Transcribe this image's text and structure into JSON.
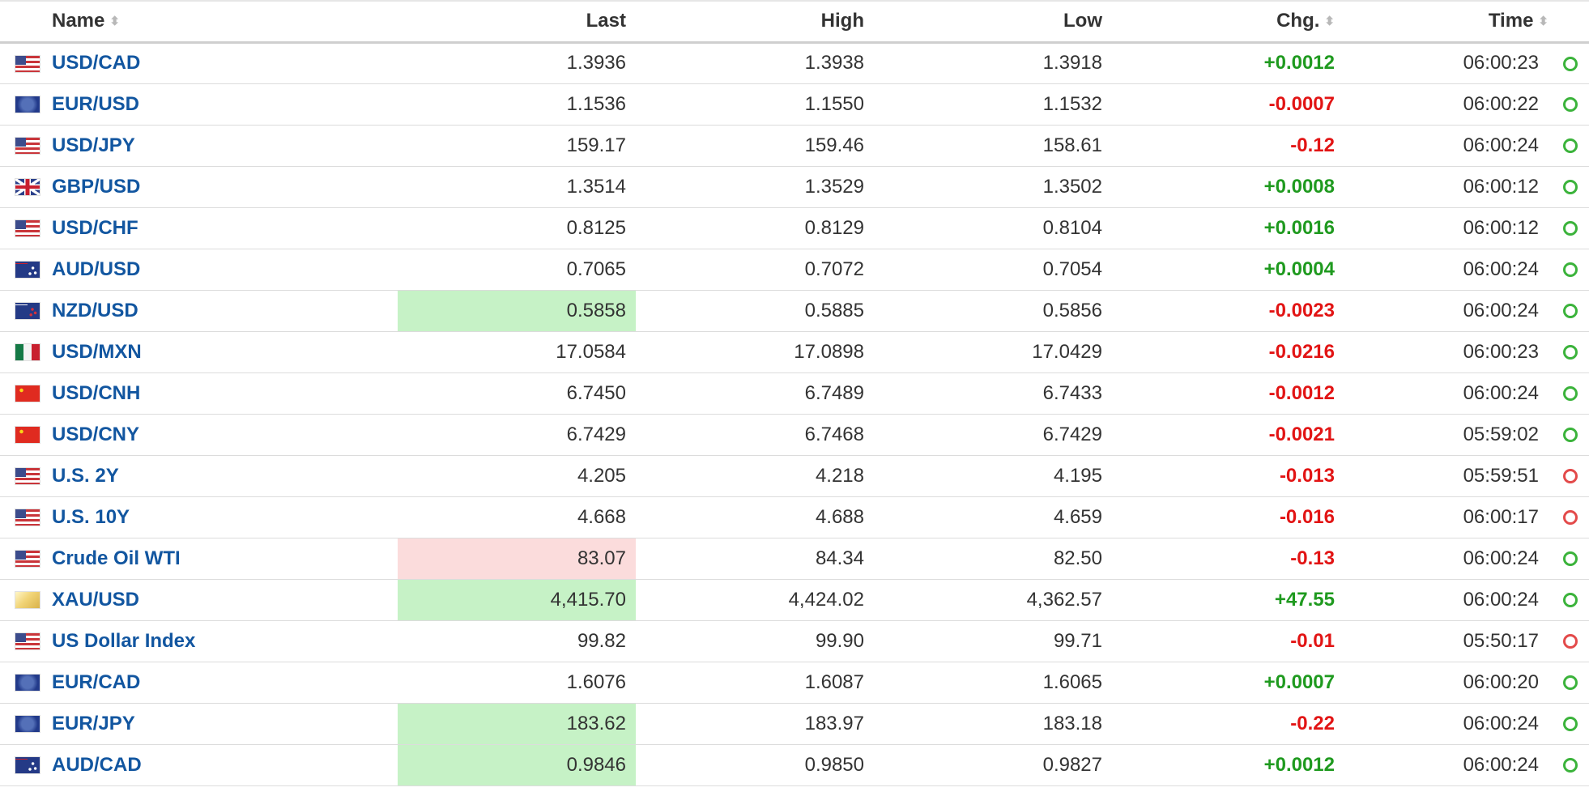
{
  "header": {
    "name": "Name",
    "last": "Last",
    "high": "High",
    "low": "Low",
    "chg": "Chg.",
    "time": "Time",
    "sort_icon": "sort-icon"
  },
  "rows": [
    {
      "name": "USD/CAD",
      "flag": "us-flag-icon",
      "last": "1.3936",
      "high": "1.3938",
      "low": "1.3918",
      "chg": "+0.0012",
      "time": "06:00:23",
      "direction": "up",
      "flash": "none",
      "status": "open"
    },
    {
      "name": "EUR/USD",
      "flag": "eu-flag-icon",
      "last": "1.1536",
      "high": "1.1550",
      "low": "1.1532",
      "chg": "-0.0007",
      "time": "06:00:22",
      "direction": "down",
      "flash": "none",
      "status": "open"
    },
    {
      "name": "USD/JPY",
      "flag": "us-flag-icon",
      "last": "159.17",
      "high": "159.46",
      "low": "158.61",
      "chg": "-0.12",
      "time": "06:00:24",
      "direction": "down",
      "flash": "none",
      "status": "open"
    },
    {
      "name": "GBP/USD",
      "flag": "uk-flag-icon",
      "last": "1.3514",
      "high": "1.3529",
      "low": "1.3502",
      "chg": "+0.0008",
      "time": "06:00:12",
      "direction": "up",
      "flash": "none",
      "status": "open"
    },
    {
      "name": "USD/CHF",
      "flag": "us-flag-icon",
      "last": "0.8125",
      "high": "0.8129",
      "low": "0.8104",
      "chg": "+0.0016",
      "time": "06:00:12",
      "direction": "up",
      "flash": "none",
      "status": "open"
    },
    {
      "name": "AUD/USD",
      "flag": "au-flag-icon",
      "last": "0.7065",
      "high": "0.7072",
      "low": "0.7054",
      "chg": "+0.0004",
      "time": "06:00:24",
      "direction": "up",
      "flash": "none",
      "status": "open"
    },
    {
      "name": "NZD/USD",
      "flag": "nz-flag-icon",
      "last": "0.5858",
      "high": "0.5885",
      "low": "0.5856",
      "chg": "-0.0023",
      "time": "06:00:24",
      "direction": "down",
      "flash": "up",
      "status": "open"
    },
    {
      "name": "USD/MXN",
      "flag": "mx-flag-icon",
      "last": "17.0584",
      "high": "17.0898",
      "low": "17.0429",
      "chg": "-0.0216",
      "time": "06:00:23",
      "direction": "down",
      "flash": "none",
      "status": "open"
    },
    {
      "name": "USD/CNH",
      "flag": "cn-flag-icon",
      "last": "6.7450",
      "high": "6.7489",
      "low": "6.7433",
      "chg": "-0.0012",
      "time": "06:00:24",
      "direction": "down",
      "flash": "none",
      "status": "open"
    },
    {
      "name": "USD/CNY",
      "flag": "cn-flag-icon",
      "last": "6.7429",
      "high": "6.7468",
      "low": "6.7429",
      "chg": "-0.0021",
      "time": "05:59:02",
      "direction": "down",
      "flash": "none",
      "status": "open"
    },
    {
      "name": "U.S. 2Y",
      "flag": "us-flag-icon",
      "last": "4.205",
      "high": "4.218",
      "low": "4.195",
      "chg": "-0.013",
      "time": "05:59:51",
      "direction": "down",
      "flash": "none",
      "status": "closed"
    },
    {
      "name": "U.S. 10Y",
      "flag": "us-flag-icon",
      "last": "4.668",
      "high": "4.688",
      "low": "4.659",
      "chg": "-0.016",
      "time": "06:00:17",
      "direction": "down",
      "flash": "none",
      "status": "closed"
    },
    {
      "name": "Crude Oil WTI",
      "flag": "us-flag-icon",
      "last": "83.07",
      "high": "84.34",
      "low": "82.50",
      "chg": "-0.13",
      "time": "06:00:24",
      "direction": "down",
      "flash": "down",
      "status": "open"
    },
    {
      "name": "XAU/USD",
      "flag": "gold-icon",
      "last": "4,415.70",
      "high": "4,424.02",
      "low": "4,362.57",
      "chg": "+47.55",
      "time": "06:00:24",
      "direction": "up",
      "flash": "up",
      "status": "open"
    },
    {
      "name": "US Dollar Index",
      "flag": "us-flag-icon",
      "last": "99.82",
      "high": "99.90",
      "low": "99.71",
      "chg": "-0.01",
      "time": "05:50:17",
      "direction": "down",
      "flash": "none",
      "status": "closed"
    },
    {
      "name": "EUR/CAD",
      "flag": "eu-flag-icon",
      "last": "1.6076",
      "high": "1.6087",
      "low": "1.6065",
      "chg": "+0.0007",
      "time": "06:00:20",
      "direction": "up",
      "flash": "none",
      "status": "open"
    },
    {
      "name": "EUR/JPY",
      "flag": "eu-flag-icon",
      "last": "183.62",
      "high": "183.97",
      "low": "183.18",
      "chg": "-0.22",
      "time": "06:00:24",
      "direction": "down",
      "flash": "up",
      "status": "open"
    },
    {
      "name": "AUD/CAD",
      "flag": "au-flag-icon",
      "last": "0.9846",
      "high": "0.9850",
      "low": "0.9827",
      "chg": "+0.0012",
      "time": "06:00:24",
      "direction": "up",
      "flash": "up",
      "status": "open"
    }
  ],
  "colors": {
    "link": "#1256a0",
    "up": "#1f9a1f",
    "down": "#e21414",
    "flash_up": "#c6f2c6",
    "flash_down": "#fbdcdc",
    "status_open": "#3bb33b",
    "status_closed": "#e34a4a"
  }
}
